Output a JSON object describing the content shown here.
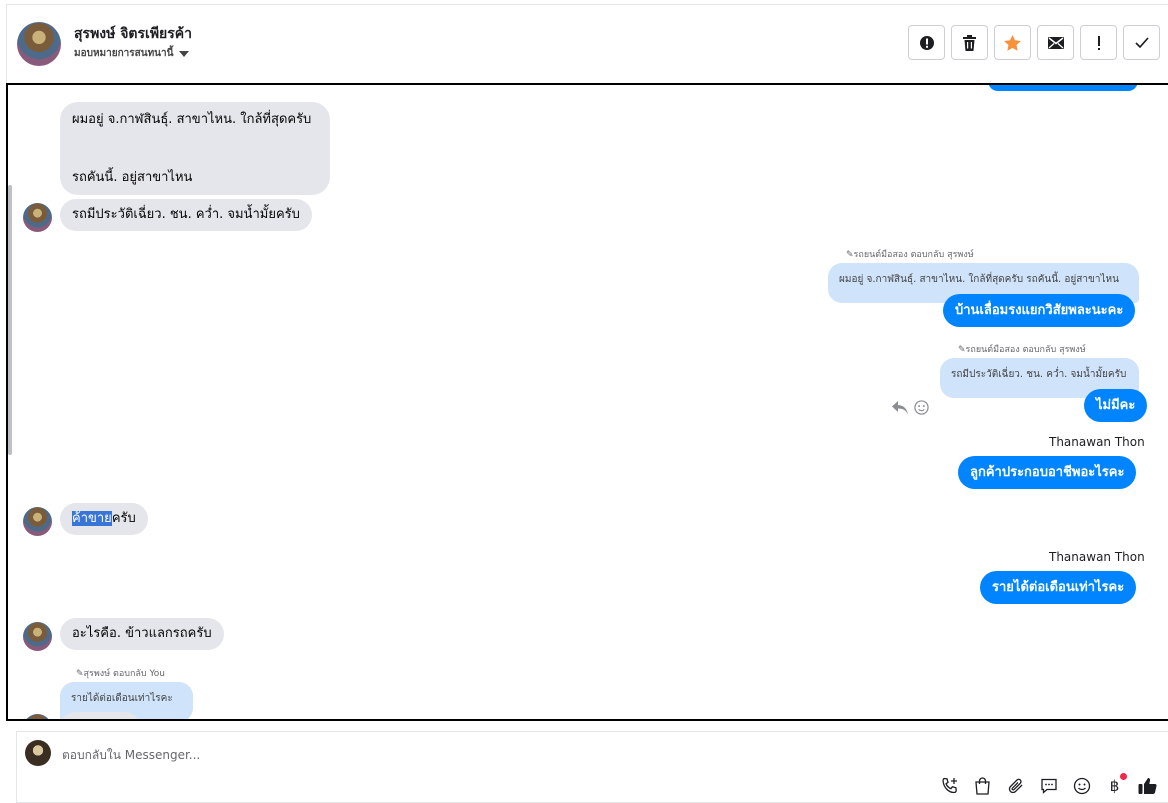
{
  "header": {
    "name": "สุรพงษ์ จิตรเพียรค้า",
    "assign_label": "มอบหมายการสนทนานี้"
  },
  "messages": {
    "m1_line1": "ผมอยู่ จ.กาฬสินธุ์. สาขาไหน. ใกล้ที่สุดครับ",
    "m1_line2": "รถคันนี้. อยู่สาขาไหน",
    "m2": "รถมีประวัติเฉี่ยว. ชน. คว่ำ. จมน้ำมั้ยครับ",
    "r1_meta": "รถยนต์มือสอง ตอบกลับ สุรพงษ์",
    "r1_quote": "ผมอยู่ จ.กาฬสินธุ์. สาขาไหน. ใกล้ที่สุดครับ รถคันนี้. อยู่สาขาไหน",
    "r1_reply": "บ้านเลื่อมรงแยกวิสัยพละนะคะ",
    "r2_meta": "รถยนต์มือสอง ตอบกลับ สุรพงษ์",
    "r2_quote": "รถมีประวัติเฉี่ยว. ชน. คว่ำ. จมน้ำมั้ยครับ",
    "r2_reply": "ไม่มีคะ",
    "sender1": "Thanawan Thon",
    "out3": "ลูกค้าประกอบอาชีพอะไรคะ",
    "in3_highlight": "ค้าขาย",
    "in3_rest": "ครับ",
    "sender2": "Thanawan Thon",
    "out4": "รายได้ต่อเดือนเท่าไรคะ",
    "in4": "อะไรคือ. ข้าวแลกรถครับ",
    "in5_meta": "สุรพงษ์ ตอบกลับ You",
    "in5_quote": "รายได้ต่อเดือนเท่าไรคะ"
  },
  "composer": {
    "placeholder": "ตอบกลับใน Messenger..."
  },
  "colors": {
    "accent": "#0084ff",
    "incoming_bubble": "#e4e6eb",
    "quote_bubble": "#cfe3fa",
    "star": "#f7923a"
  },
  "icons": [
    "alert-icon",
    "trash-icon",
    "star-icon",
    "envelope-icon",
    "exclamation-icon",
    "check-icon",
    "reply-icon",
    "emoji-icon",
    "call-add-icon",
    "shopping-bag-icon",
    "paperclip-icon",
    "chat-bubble-icon",
    "smiley-icon",
    "baht-icon",
    "thumbs-up-icon"
  ]
}
